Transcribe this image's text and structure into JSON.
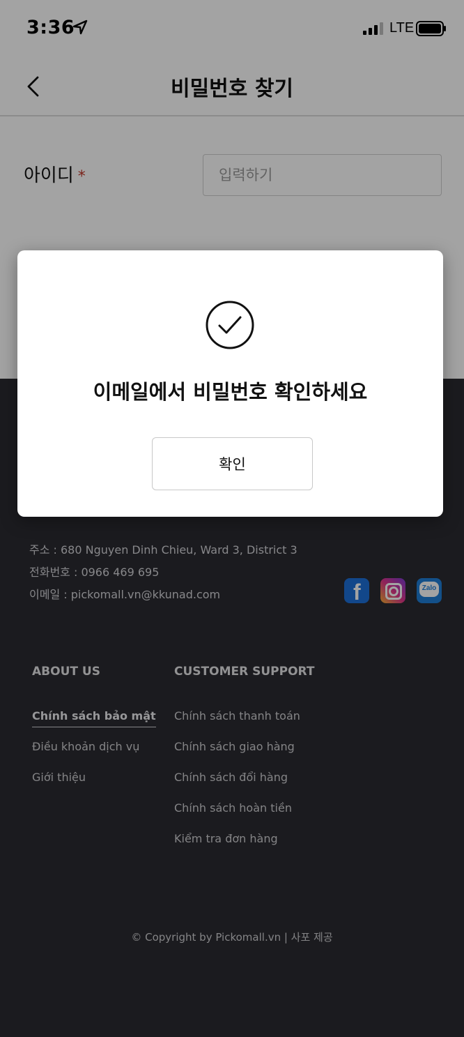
{
  "status_bar": {
    "time": "3:36",
    "network": "LTE",
    "icons": [
      "location-arrow-icon",
      "signal-icon",
      "battery-icon"
    ]
  },
  "header": {
    "title": "비밀번호 찾기",
    "back_icon": "chevron-left-icon"
  },
  "form": {
    "id_label": "아이디",
    "required_mark": "*",
    "id_placeholder": "입력하기"
  },
  "modal": {
    "icon": "check-circle-icon",
    "message": "이메일에서 비밀번호 확인하세요",
    "confirm_label": "확인"
  },
  "footer": {
    "address": "주소 : 680 Nguyen Dinh Chieu, Ward 3, District 3",
    "phone": "전화번호 : 0966 469 695",
    "email": "이메일 : pickomall.vn@kkunad.com",
    "social": {
      "facebook_glyph": "f",
      "zalo_label": "Zalo"
    },
    "about_title": "ABOUT US",
    "about_links": [
      "Chính sách bảo mật",
      "Điều khoản dịch vụ",
      "Giới thiệu"
    ],
    "support_title": "CUSTOMER SUPPORT",
    "support_links": [
      "Chính sách thanh toán",
      "Chính sách giao hàng",
      "Chính sách đổi hàng",
      "Chính sách hoàn tiền",
      "Kiểm tra đơn hàng"
    ],
    "copyright": "© Copyright by Pickomall.vn | 사포 제공"
  },
  "colors": {
    "footer_bg": "#2b2b31",
    "required": "#c0392b",
    "facebook": "#1d6fd8",
    "zalo": "#1f7ed6"
  }
}
